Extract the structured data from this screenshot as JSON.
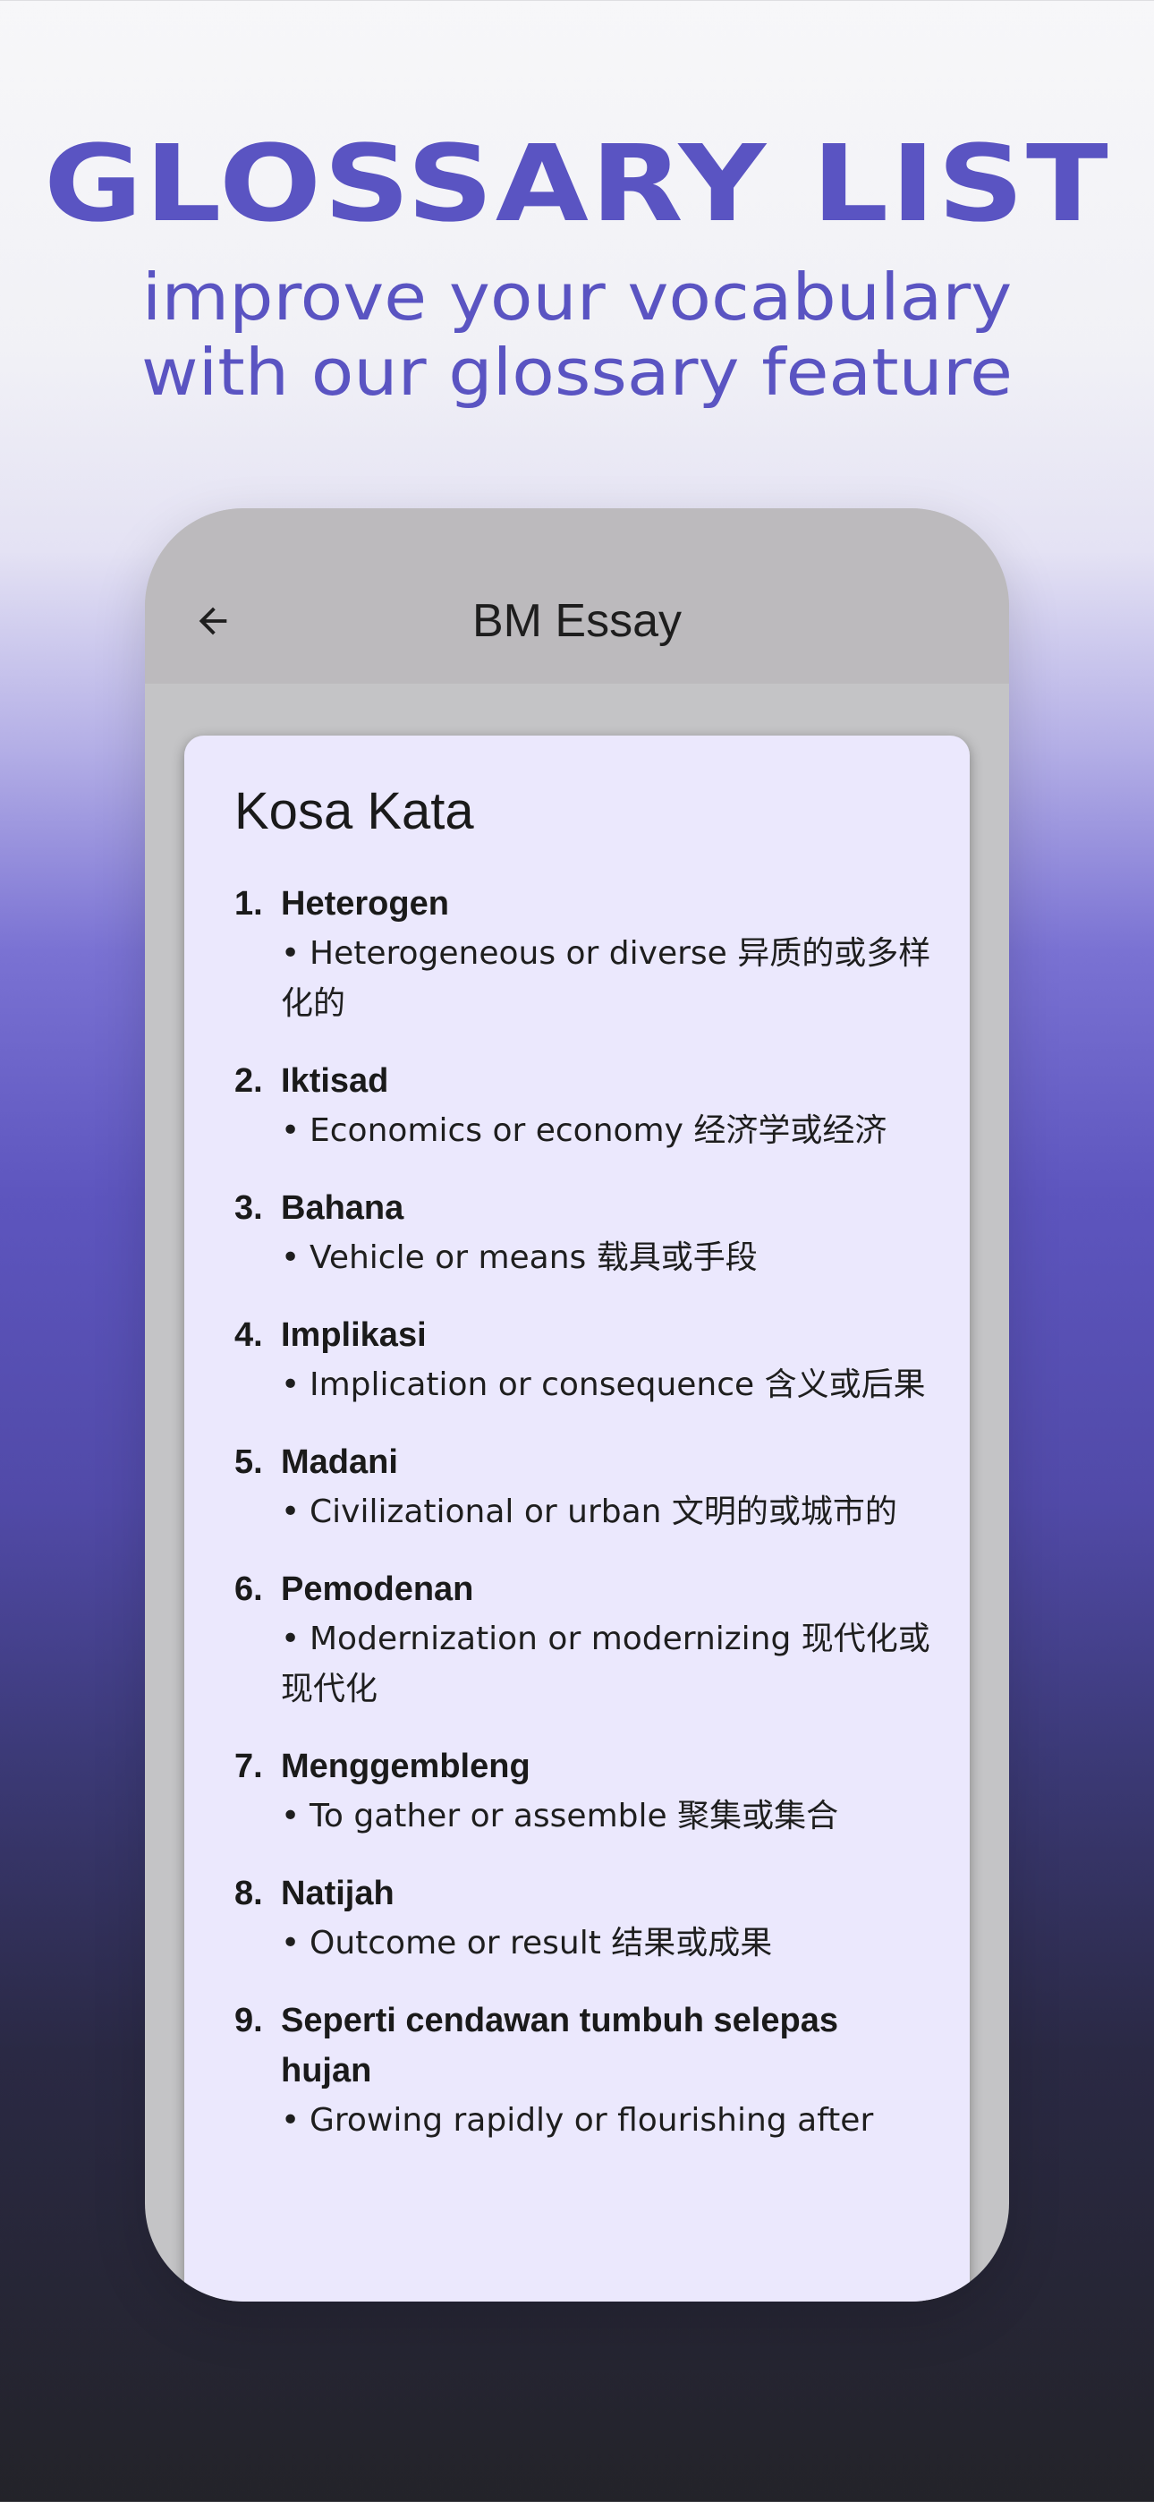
{
  "hero": {
    "title": "GLOSSARY LIST",
    "subtitle_line1": "improve your vocabulary",
    "subtitle_line2": "with our glossary feature"
  },
  "appbar": {
    "back_icon": "arrow-left-icon",
    "title": "BM Essay"
  },
  "card": {
    "title": "Kosa Kata",
    "bullet": "•",
    "entries": [
      {
        "num": "1.",
        "term": "Heterogen",
        "meaning": "Heterogeneous or diverse 异质的或多样化的"
      },
      {
        "num": "2.",
        "term": "Iktisad",
        "meaning": "Economics or economy 经济学或经济"
      },
      {
        "num": "3.",
        "term": "Bahana",
        "meaning": "Vehicle or means 载具或手段"
      },
      {
        "num": "4.",
        "term": "Implikasi",
        "meaning": "Implication or consequence 含义或后果"
      },
      {
        "num": "5.",
        "term": "Madani",
        "meaning": "Civilizational or urban 文明的或城市的"
      },
      {
        "num": "6.",
        "term": "Pemodenan",
        "meaning": "Modernization or modernizing 现代化或现代化"
      },
      {
        "num": "7.",
        "term": "Menggembleng",
        "meaning": "To gather or assemble 聚集或集合"
      },
      {
        "num": "8.",
        "term": "Natijah",
        "meaning": "Outcome or result 结果或成果"
      },
      {
        "num": "9.",
        "term": "Seperti cendawan tumbuh selepas hujan",
        "meaning": "Growing rapidly or flourishing after"
      }
    ]
  },
  "colors": {
    "accent": "#5a54c2",
    "card_bg": "#ebe8fd",
    "appbar_bg": "#bcbabd"
  }
}
